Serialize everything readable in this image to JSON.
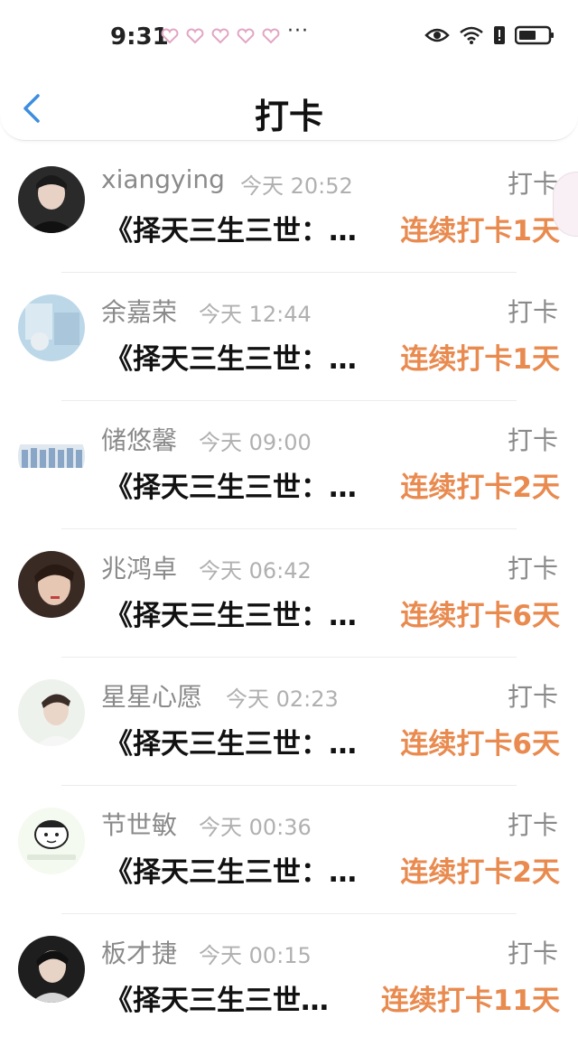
{
  "status": {
    "time": "9:31",
    "overflow": "···"
  },
  "nav": {
    "title": "打卡",
    "back_icon": "chevron-left-icon"
  },
  "colors": {
    "accent": "#e98a4f",
    "back": "#3d8de0"
  },
  "items": [
    {
      "name": "xiangying",
      "time": "今天 20:52",
      "tag": "打卡",
      "book": "《择天三生三世：…",
      "streak": "连续打卡1天"
    },
    {
      "name": "余嘉荣",
      "time": "今天 12:44",
      "tag": "打卡",
      "book": "《择天三生三世：…",
      "streak": "连续打卡1天"
    },
    {
      "name": "储悠馨",
      "time": "今天 09:00",
      "tag": "打卡",
      "book": "《择天三生三世：…",
      "streak": "连续打卡2天"
    },
    {
      "name": "兆鸿卓",
      "time": "今天 06:42",
      "tag": "打卡",
      "book": "《择天三生三世：…",
      "streak": "连续打卡6天"
    },
    {
      "name": "星星心愿",
      "time": "今天 02:23",
      "tag": "打卡",
      "book": "《择天三生三世：…",
      "streak": "连续打卡6天"
    },
    {
      "name": "节世敏",
      "time": "今天 00:36",
      "tag": "打卡",
      "book": "《择天三生三世：…",
      "streak": "连续打卡2天"
    },
    {
      "name": "板才捷",
      "time": "今天 00:15",
      "tag": "打卡",
      "book": "《择天三生三世…",
      "streak": "连续打卡11天"
    }
  ]
}
